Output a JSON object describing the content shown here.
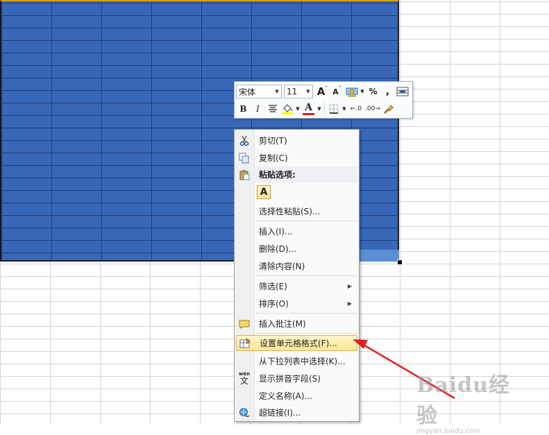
{
  "mini_toolbar": {
    "font_name": "宋体",
    "font_size": "11",
    "grow_font": "A",
    "shrink_font": "A",
    "percent": "%",
    "comma": ",",
    "bold": "B",
    "italic": "I",
    "font_color_letter": "A",
    "inc_decimal": "←.0",
    "dec_decimal": ".00→",
    "font_color_hex": "#d32020",
    "fill_color_hex": "#ffff00"
  },
  "context_menu": {
    "cut": "剪切(T)",
    "copy": "复制(C)",
    "paste_options": "粘贴选项:",
    "paste_a": "A",
    "paste_special": "选择性粘贴(S)...",
    "insert": "插入(I)...",
    "delete": "删除(D)...",
    "clear_contents": "清除内容(N)",
    "filter": "筛选(E)",
    "sort": "排序(O)",
    "insert_comment": "插入批注(M)",
    "format_cells": "设置单元格格式(F)...",
    "pick_from_list": "从下拉列表中选择(K)...",
    "show_phonetic": "显示拼音字段(S)",
    "define_name": "定义名称(A)...",
    "hyperlink": "超链接(I)...",
    "phonetic_icon_text": "wén"
  },
  "watermark": {
    "brand": "Baidu经验",
    "url": "jingyan.baidu.com"
  },
  "colors": {
    "selection": "#3867b8",
    "arrow": "#e02020",
    "highlight": "#ffe68f"
  }
}
